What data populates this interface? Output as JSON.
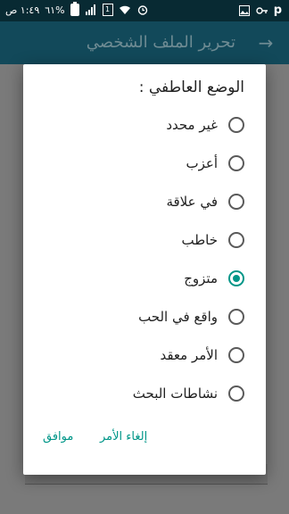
{
  "status_bar": {
    "time": "١:٤٩ ص",
    "battery": "٦١%",
    "network": "1",
    "carrier_icon": "p"
  },
  "toolbar": {
    "title": "تحرير الملف الشخصي"
  },
  "dialog": {
    "title": "الوضع العاطفي :",
    "options": [
      {
        "label": "غير محدد",
        "checked": false
      },
      {
        "label": "أعزب",
        "checked": false
      },
      {
        "label": "في علاقة",
        "checked": false
      },
      {
        "label": "خاطب",
        "checked": false
      },
      {
        "label": "متزوج",
        "checked": true
      },
      {
        "label": "واقع في الحب",
        "checked": false
      },
      {
        "label": "الأمر معقد",
        "checked": false
      },
      {
        "label": "نشاطات البحث",
        "checked": false
      }
    ],
    "cancel_label": "إلغاء الأمر",
    "ok_label": "موافق"
  },
  "colors": {
    "accent": "#009688",
    "toolbar": "#12495a",
    "statusbar": "#082a33"
  }
}
